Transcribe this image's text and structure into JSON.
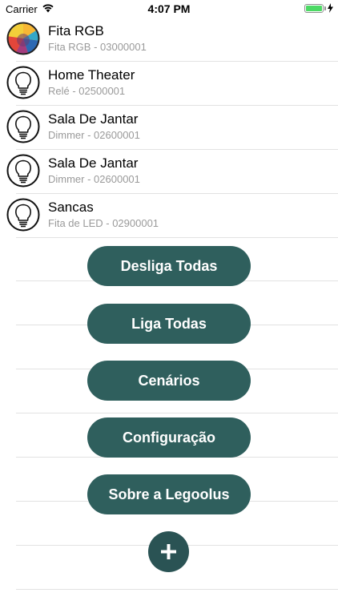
{
  "status_bar": {
    "carrier": "Carrier",
    "time": "4:07 PM",
    "battery_level": 1.0,
    "battery_color": "#4cd964"
  },
  "devices": [
    {
      "name": "Fita RGB",
      "subtitle": "Fita RGB - 03000001",
      "icon": "rgb-color-wheel-icon"
    },
    {
      "name": "Home Theater",
      "subtitle": "Relé - 02500001",
      "icon": "lightbulb-icon"
    },
    {
      "name": "Sala De Jantar",
      "subtitle": "Dimmer - 02600001",
      "icon": "lightbulb-icon"
    },
    {
      "name": "Sala De Jantar",
      "subtitle": "Dimmer - 02600001",
      "icon": "lightbulb-icon"
    },
    {
      "name": "Sancas",
      "subtitle": "Fita de LED - 02900001",
      "icon": "lightbulb-icon"
    }
  ],
  "actions": {
    "turn_off_all": "Desliga Todas",
    "turn_on_all": "Liga Todas",
    "scenes": "Cenários",
    "settings": "Configuração",
    "about": "Sobre a Legoolus"
  },
  "add_button": {
    "icon": "plus-icon"
  },
  "colors": {
    "button_bg": "#2f5f5d",
    "add_button_bg": "#2a5354",
    "subtitle_text": "#9a9a9a",
    "divider": "#e2e2e2"
  }
}
